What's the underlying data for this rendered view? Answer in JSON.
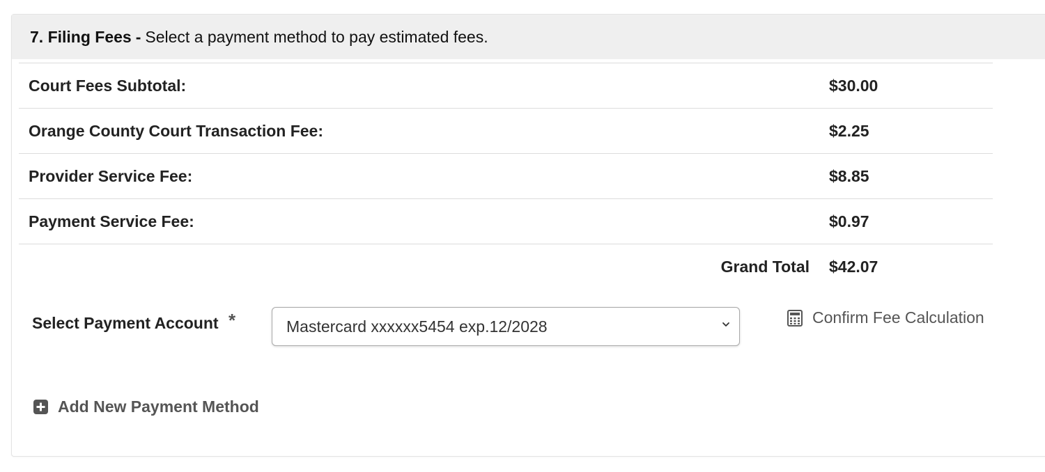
{
  "section": {
    "number_title": "7. Filing Fees",
    "separator": "-",
    "description": "Select a payment method to pay estimated fees."
  },
  "fees": [
    {
      "label": "Court Fees Subtotal:",
      "amount": "$30.00"
    },
    {
      "label": "Orange County Court Transaction Fee:",
      "amount": "$2.25"
    },
    {
      "label": "Provider Service Fee:",
      "amount": "$8.85"
    },
    {
      "label": "Payment Service Fee:",
      "amount": "$0.97"
    }
  ],
  "total": {
    "label": "Grand Total",
    "amount": "$42.07"
  },
  "payment": {
    "label": "Select Payment Account",
    "required_marker": "*",
    "selected_account": "Mastercard xxxxxx5454 exp.12/2028",
    "confirm_label": "Confirm Fee Calculation",
    "add_method_label": "Add New Payment Method"
  },
  "icons": {
    "select_chevron": "chevron-down-icon",
    "confirm": "calculator-icon",
    "add": "plus-square-icon"
  }
}
